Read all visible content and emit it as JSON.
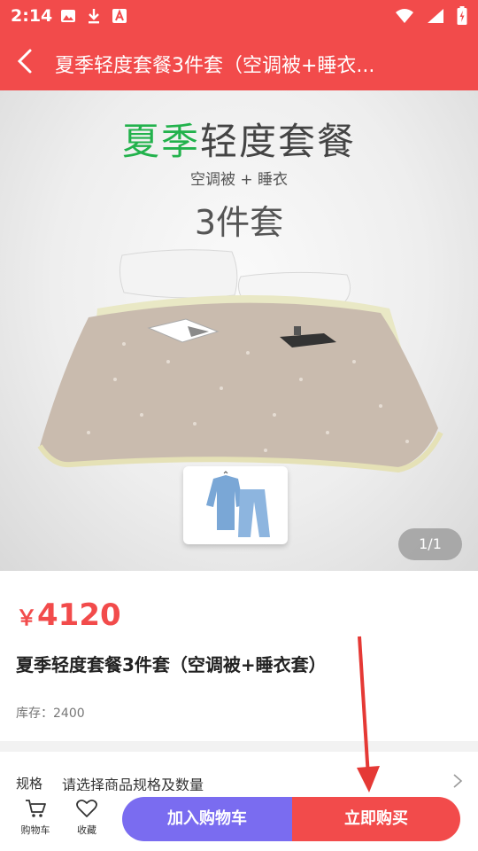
{
  "status_bar": {
    "time": "2:14",
    "left_icons": [
      "image-icon",
      "download-icon",
      "a-box-icon"
    ],
    "right_icons": [
      "wifi-icon",
      "signal-icon",
      "battery-icon"
    ]
  },
  "navbar": {
    "title": "夏季轻度套餐3件套（空调被+睡衣..."
  },
  "hero": {
    "title_highlight": "夏季",
    "title_rest": "轻度套餐",
    "subtitle": "空调被 +  睡衣",
    "count": "3件套",
    "pager": "1/1"
  },
  "product": {
    "currency": "￥",
    "price": "4120",
    "title": "夏季轻度套餐3件套（空调被+睡衣套）",
    "stock_label": "库存：",
    "stock_value": "2400"
  },
  "spec": {
    "label": "规格",
    "value": "请选择商品规格及数量"
  },
  "bottom_bar": {
    "cart_label": "购物车",
    "favorite_label": "收藏",
    "add_to_cart": "加入购物车",
    "buy_now": "立即购买"
  },
  "colors": {
    "brand_red": "#f24b4b",
    "cart_purple": "#7a6cf0",
    "title_green": "#22b24c"
  }
}
